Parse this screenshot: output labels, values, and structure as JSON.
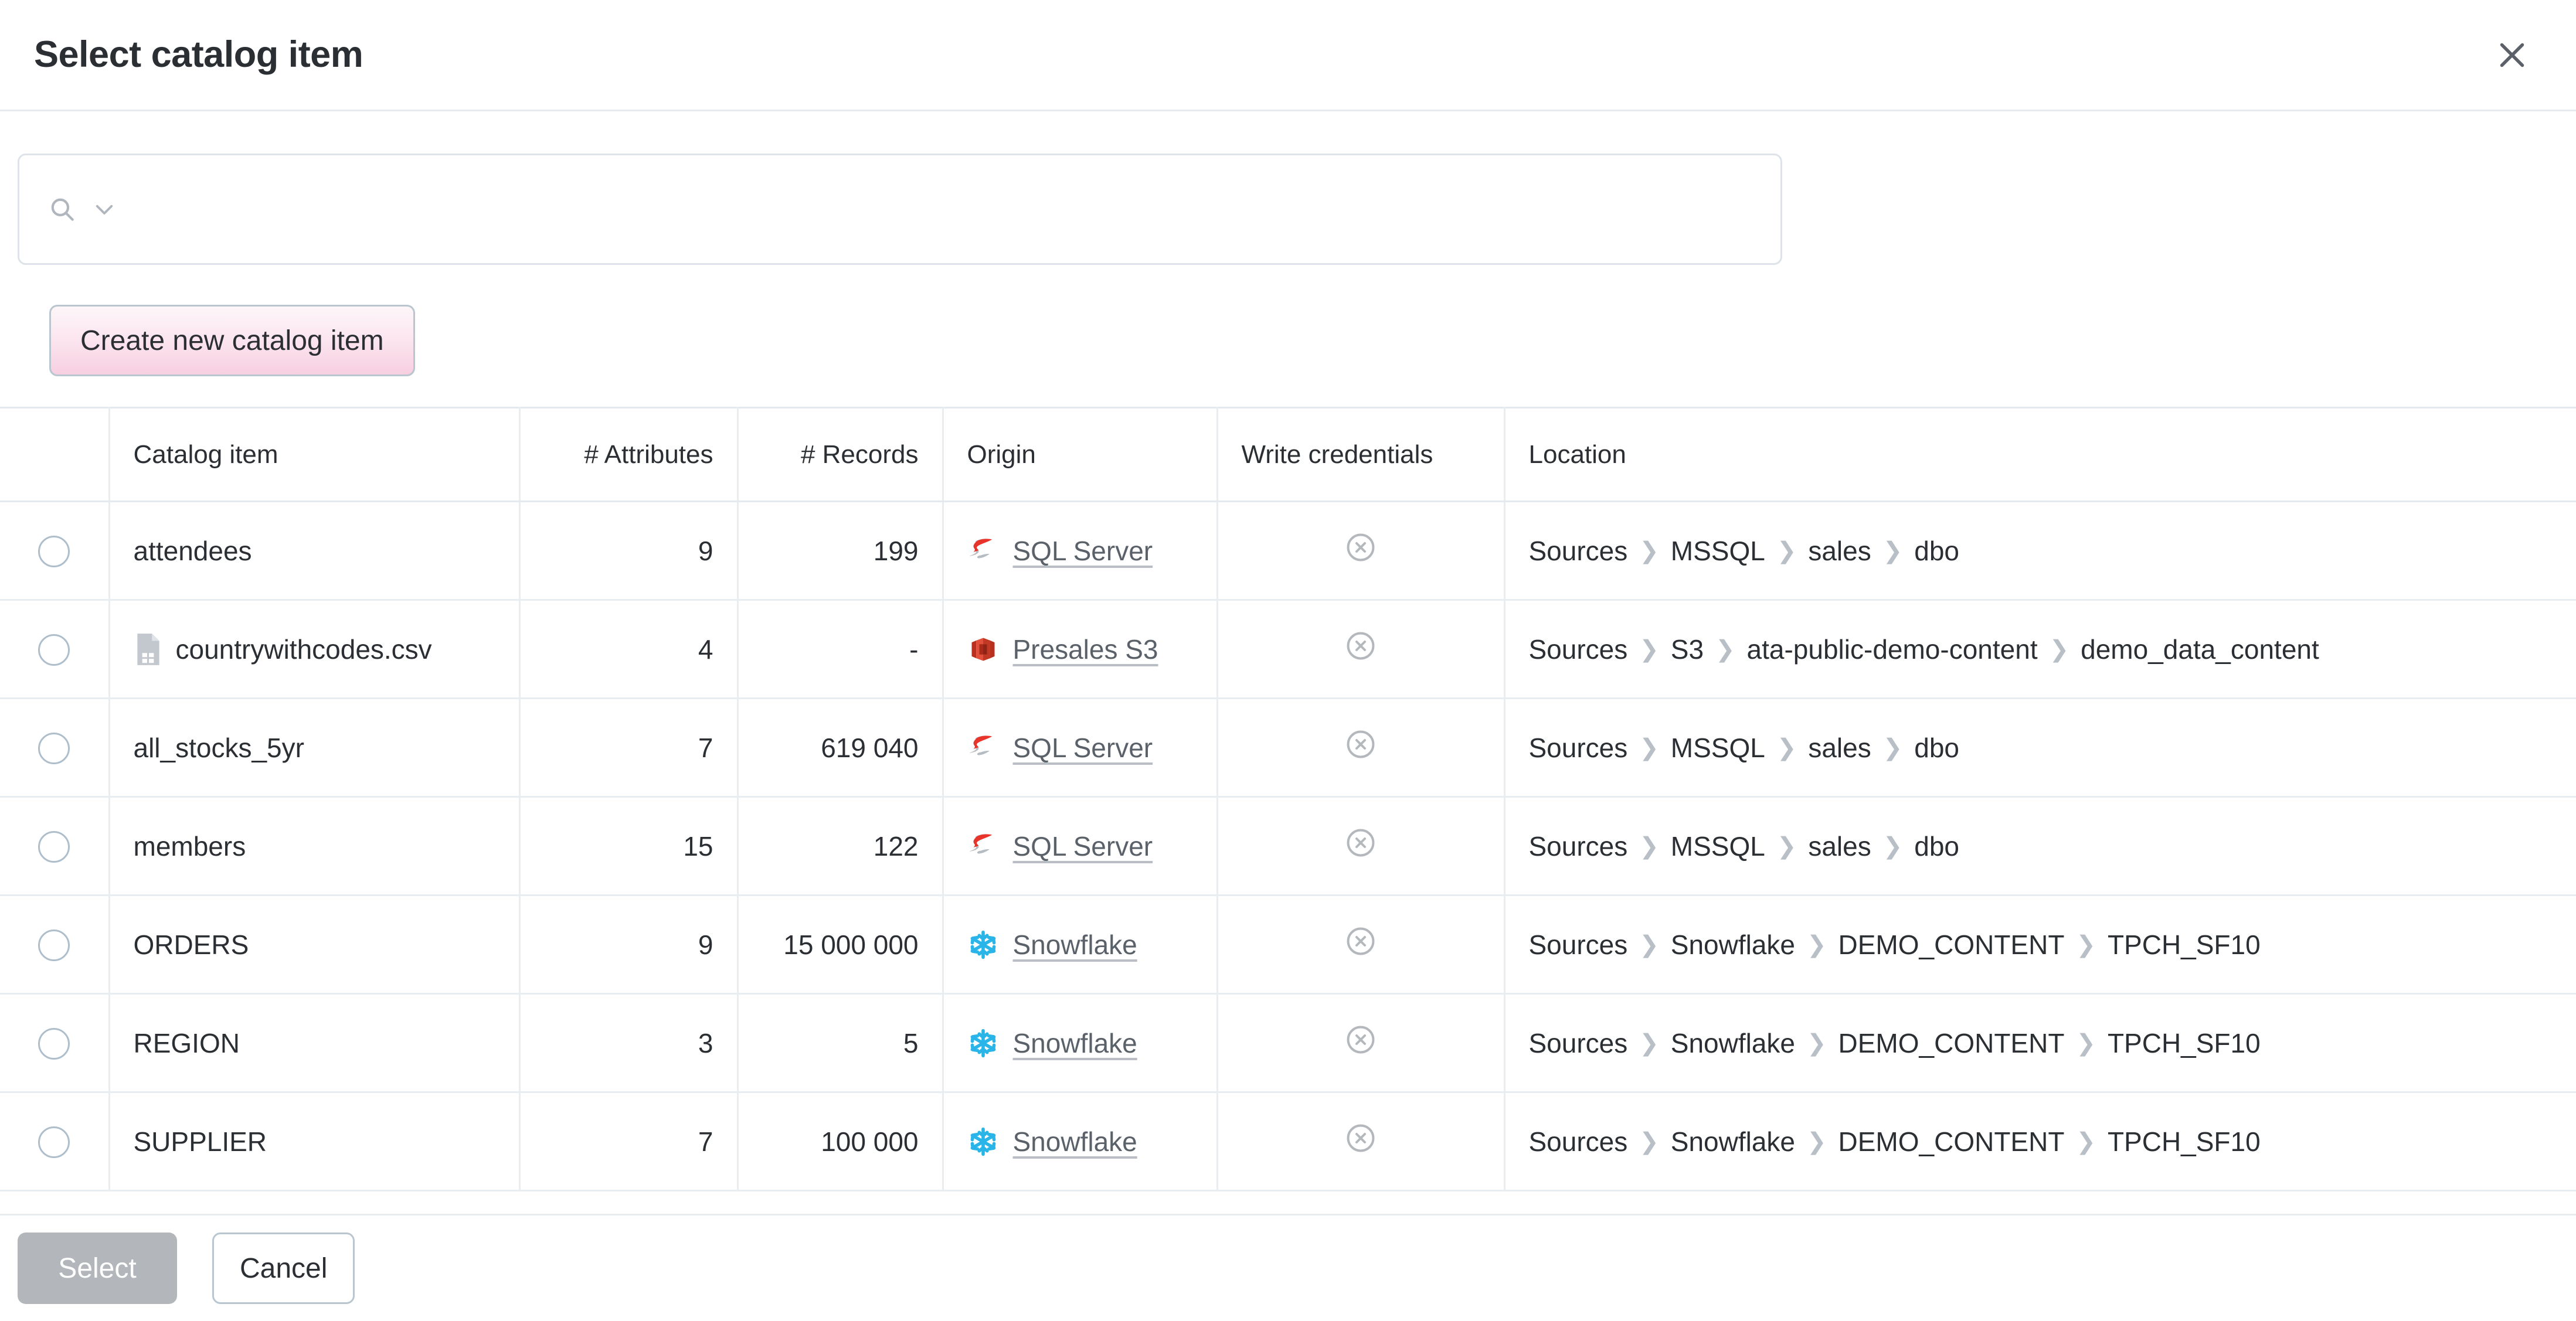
{
  "dialog": {
    "title": "Select catalog item",
    "close_icon": "close-icon"
  },
  "search": {
    "value": "",
    "placeholder": "",
    "search_icon": "search-icon",
    "chevron_icon": "chevron-down-icon"
  },
  "toolbar": {
    "create_label": "Create new catalog item"
  },
  "table": {
    "columns": [
      {
        "key": "radio",
        "label": ""
      },
      {
        "key": "name",
        "label": "Catalog item"
      },
      {
        "key": "attrs",
        "label": "# Attributes"
      },
      {
        "key": "recs",
        "label": "# Records"
      },
      {
        "key": "origin",
        "label": "Origin"
      },
      {
        "key": "cred",
        "label": "Write credentials"
      },
      {
        "key": "loc",
        "label": "Location"
      }
    ],
    "rows": [
      {
        "name": "attendees",
        "file_icon": null,
        "attributes": "9",
        "records": "199",
        "origin": "SQL Server",
        "origin_icon": "sql-server-icon",
        "write_credentials": "circle-x-icon",
        "location": [
          "Sources",
          "MSSQL",
          "sales",
          "dbo"
        ]
      },
      {
        "name": "countrywithcodes.csv",
        "file_icon": "csv-file-icon",
        "attributes": "4",
        "records": "-",
        "origin": "Presales S3",
        "origin_icon": "aws-s3-icon",
        "write_credentials": "circle-x-icon",
        "location": [
          "Sources",
          "S3",
          "ata-public-demo-content",
          "demo_data_content"
        ]
      },
      {
        "name": "all_stocks_5yr",
        "file_icon": null,
        "attributes": "7",
        "records": "619 040",
        "origin": "SQL Server",
        "origin_icon": "sql-server-icon",
        "write_credentials": "circle-x-icon",
        "location": [
          "Sources",
          "MSSQL",
          "sales",
          "dbo"
        ]
      },
      {
        "name": "members",
        "file_icon": null,
        "attributes": "15",
        "records": "122",
        "origin": "SQL Server",
        "origin_icon": "sql-server-icon",
        "write_credentials": "circle-x-icon",
        "location": [
          "Sources",
          "MSSQL",
          "sales",
          "dbo"
        ]
      },
      {
        "name": "ORDERS",
        "file_icon": null,
        "attributes": "9",
        "records": "15 000 000",
        "origin": "Snowflake",
        "origin_icon": "snowflake-icon",
        "write_credentials": "circle-x-icon",
        "location": [
          "Sources",
          "Snowflake",
          "DEMO_CONTENT",
          "TPCH_SF10"
        ]
      },
      {
        "name": "REGION",
        "file_icon": null,
        "attributes": "3",
        "records": "5",
        "origin": "Snowflake",
        "origin_icon": "snowflake-icon",
        "write_credentials": "circle-x-icon",
        "location": [
          "Sources",
          "Snowflake",
          "DEMO_CONTENT",
          "TPCH_SF10"
        ]
      },
      {
        "name": "SUPPLIER",
        "file_icon": null,
        "attributes": "7",
        "records": "100 000",
        "origin": "Snowflake",
        "origin_icon": "snowflake-icon",
        "write_credentials": "circle-x-icon",
        "location": [
          "Sources",
          "Snowflake",
          "DEMO_CONTENT",
          "TPCH_SF10"
        ]
      }
    ]
  },
  "footer": {
    "select_label": "Select",
    "cancel_label": "Cancel"
  },
  "colors": {
    "sql_server_red": "#e8342a",
    "s3_red": "#e2503b",
    "snowflake_blue": "#29b5e8",
    "create_btn_pink": "#f7cfe0",
    "disabled_gray": "#b3b6bb",
    "border": "#e8edf1"
  }
}
